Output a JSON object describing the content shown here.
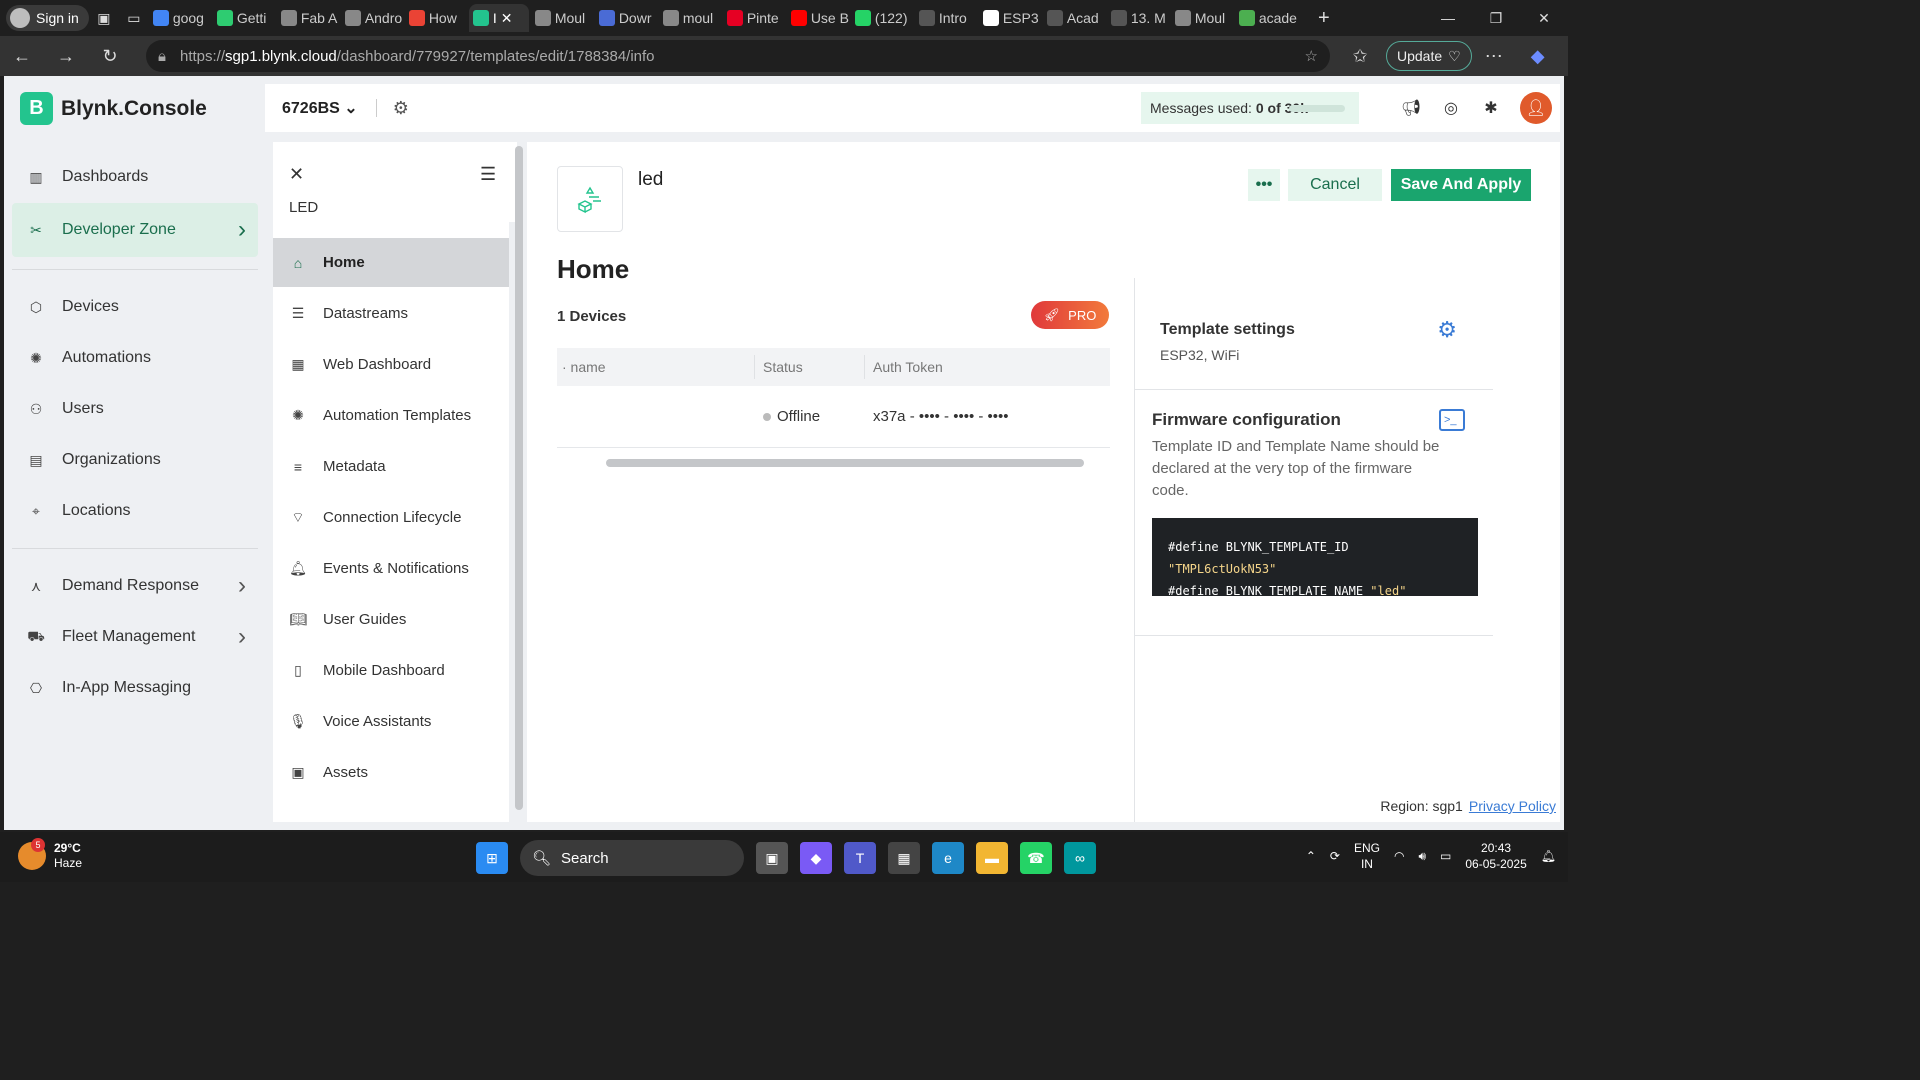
{
  "browser": {
    "signin_label": "Sign in",
    "tabs": [
      {
        "label": "goog",
        "color": "#4285f4"
      },
      {
        "label": "Getti",
        "color": "#2ecc71"
      },
      {
        "label": "Fab A",
        "color": "#888888"
      },
      {
        "label": "Andro",
        "color": "#888888"
      },
      {
        "label": "How",
        "color": "#ea4335"
      },
      {
        "label": "I",
        "color": "#23c48e"
      },
      {
        "label": "Moul",
        "color": "#888888"
      },
      {
        "label": "Dowr",
        "color": "#4a6bd5"
      },
      {
        "label": "moul",
        "color": "#888888"
      },
      {
        "label": "Pinte",
        "color": "#e60023"
      },
      {
        "label": "Use B",
        "color": "#ff0000"
      },
      {
        "label": "(122)",
        "color": "#25d366"
      },
      {
        "label": "Intro",
        "color": "#555555"
      },
      {
        "label": "ESP3",
        "color": "#ffffff"
      },
      {
        "label": "Acad",
        "color": "#555555"
      },
      {
        "label": "13. M",
        "color": "#555555"
      },
      {
        "label": "Moul",
        "color": "#888888"
      },
      {
        "label": "acade",
        "color": "#4caf50"
      }
    ],
    "url_prefix": "https://",
    "url_host": "sgp1.blynk.cloud",
    "url_path": "/dashboard/779927/templates/edit/1788384/info",
    "update_label": "Update"
  },
  "app": {
    "logo_letter": "B",
    "logo_text": "Blynk.Console",
    "org_name": "6726BS",
    "messages_label": "Messages used:",
    "messages_value": "0 of 30k"
  },
  "main_nav": [
    {
      "label": "Dashboards",
      "icon": "chart-icon"
    },
    {
      "label": "Developer Zone",
      "icon": "tools-icon"
    },
    {
      "label": "Devices",
      "icon": "cube-icon"
    },
    {
      "label": "Automations",
      "icon": "automation-icon"
    },
    {
      "label": "Users",
      "icon": "users-icon"
    },
    {
      "label": "Organizations",
      "icon": "building-icon"
    },
    {
      "label": "Locations",
      "icon": "pin-icon"
    },
    {
      "label": "Demand Response",
      "icon": "demand-icon"
    },
    {
      "label": "Fleet Management",
      "icon": "truck-icon"
    },
    {
      "label": "In-App Messaging",
      "icon": "message-icon"
    }
  ],
  "template_nav": {
    "template_name": "LED",
    "items": [
      {
        "label": "Home"
      },
      {
        "label": "Datastreams"
      },
      {
        "label": "Web Dashboard"
      },
      {
        "label": "Automation Templates"
      },
      {
        "label": "Metadata"
      },
      {
        "label": "Connection Lifecycle"
      },
      {
        "label": "Events & Notifications"
      },
      {
        "label": "User Guides"
      },
      {
        "label": "Mobile Dashboard"
      },
      {
        "label": "Voice Assistants"
      },
      {
        "label": "Assets"
      }
    ]
  },
  "content": {
    "template_title": "led",
    "more_label": "•••",
    "cancel_label": "Cancel",
    "save_label": "Save And Apply",
    "section_title": "Home",
    "devices_count": "1 Devices",
    "pro_label": "PRO",
    "table": {
      "headers": [
        "· name",
        "Status",
        "Auth Token"
      ],
      "rows": [
        {
          "name": "",
          "status": "Offline",
          "token": "x37a - •••• - •••• - ••••"
        }
      ]
    }
  },
  "settings": {
    "title": "Template settings",
    "subtitle": "ESP32, WiFi",
    "firmware_title": "Firmware configuration",
    "firmware_desc": "Template ID and Template Name should be declared at the very top of the firmware code.",
    "code_line1_prefix": "#define BLYNK_TEMPLATE_ID ",
    "code_line1_value": "\"TMPL6ctUokN53\"",
    "code_line2_prefix": "#define BLYNK_TEMPLATE_NAME ",
    "code_line2_value": "\"led\""
  },
  "footer": {
    "region": "Region: sgp1",
    "privacy": "Privacy Policy"
  },
  "taskbar": {
    "weather_badge": "5",
    "temperature": "29°C",
    "condition": "Haze",
    "search_label": "Search",
    "lang_line1": "ENG",
    "lang_line2": "IN",
    "time": "20:43",
    "date": "06-05-2025"
  }
}
